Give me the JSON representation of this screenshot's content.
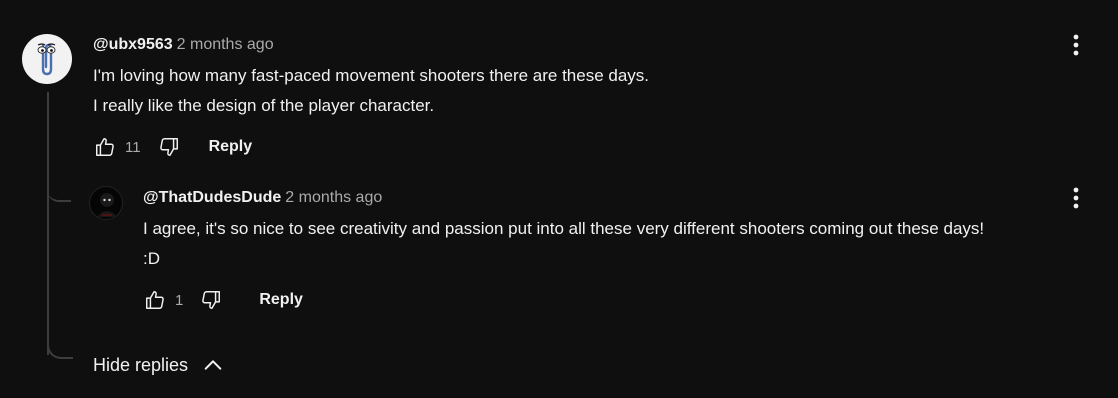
{
  "comment": {
    "author": "@ubx9563",
    "time": "2 months ago",
    "text": "I'm loving how many fast-paced movement shooters there are these days.\n I really like the design of the player character.",
    "likes": "11",
    "reply_label": "Reply",
    "avatar_icon": "paperclip-icon"
  },
  "reply": {
    "author": "@ThatDudesDude",
    "time": "2 months ago",
    "text": "I agree, it's so nice to see creativity and passion put into all these very different shooters coming out these days!\n:D",
    "likes": "1",
    "reply_label": "Reply",
    "avatar_icon": "dark-figure-icon"
  },
  "hide_replies_label": "Hide replies",
  "colors": {
    "background": "#0f0f0f",
    "primary_text": "#f1f1f1",
    "secondary_text": "#aaaaaa",
    "thread_line": "#3d3d3d"
  }
}
